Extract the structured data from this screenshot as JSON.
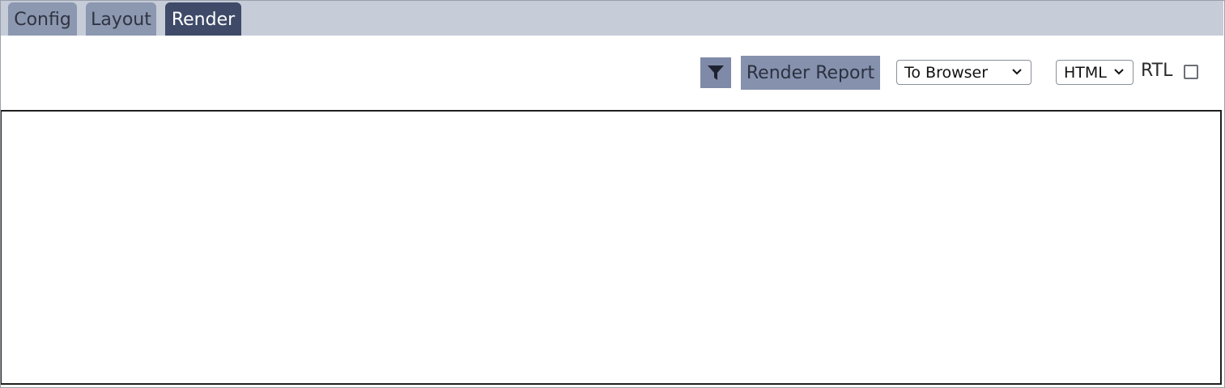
{
  "tabs": [
    {
      "label": "Config",
      "active": false
    },
    {
      "label": "Layout",
      "active": false
    },
    {
      "label": "Render",
      "active": true
    }
  ],
  "toolbar": {
    "filter_icon": "filter-icon",
    "render_button_label": "Render Report",
    "destination_select": {
      "value": "To Browser"
    },
    "format_select": {
      "value": "HTML"
    },
    "rtl_label": "RTL",
    "rtl_checked": false
  },
  "colors": {
    "tab_strip": "#c6ccd8",
    "tab_inactive": "#8c97b0",
    "tab_active": "#3e4a68",
    "button_bg": "#8591ad"
  }
}
